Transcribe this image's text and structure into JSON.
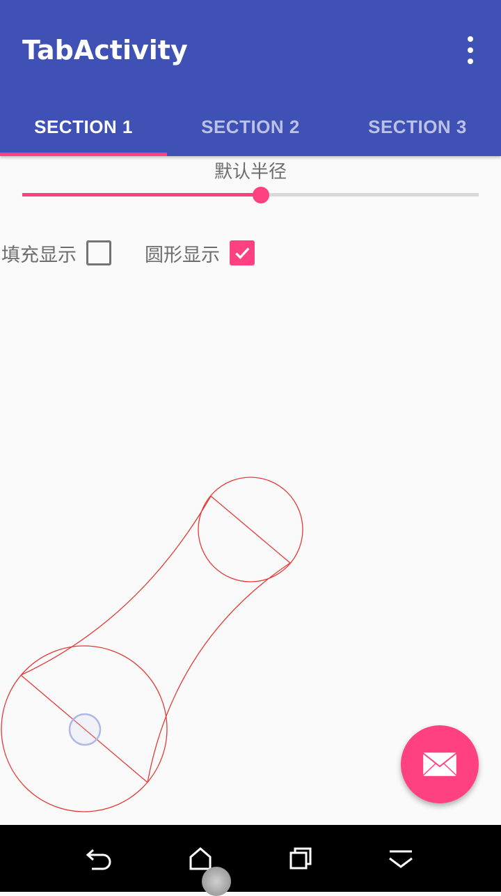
{
  "app_bar": {
    "title": "TabActivity",
    "background_color": "#3f51b5",
    "overflow_icon": "more-vert-icon"
  },
  "tabs": [
    {
      "label": "SECTION 1",
      "active": true
    },
    {
      "label": "SECTION 2",
      "active": false
    },
    {
      "label": "SECTION 3",
      "active": false
    }
  ],
  "accent_color": "#ff4081",
  "controls": {
    "radius_label": "默认半径",
    "radius_slider_value": 0.523,
    "fill_label": "填充显示",
    "fill_checked": false,
    "circle_label": "圆形显示",
    "circle_checked": true
  },
  "drawing": {
    "stroke_color": "#e53935",
    "touch_marker_color": "#b0b8e8"
  },
  "fab": {
    "icon": "email-icon"
  },
  "nav_bar": {
    "icons": [
      "back-icon",
      "home-icon",
      "recents-icon",
      "collapse-icon"
    ]
  }
}
